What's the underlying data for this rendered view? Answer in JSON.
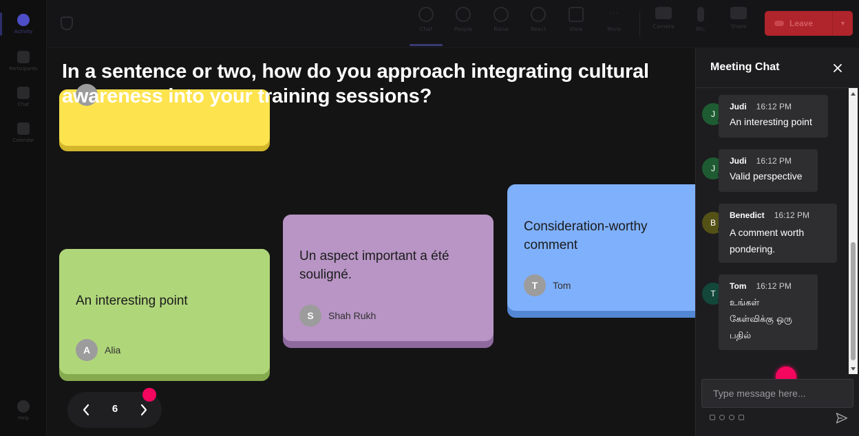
{
  "rail": {
    "items": [
      {
        "label": "Activity",
        "active": true
      },
      {
        "label": "Participants",
        "active": false
      },
      {
        "label": "Chat",
        "active": false
      },
      {
        "label": "Calendar",
        "active": false
      }
    ],
    "help_label": "Help"
  },
  "toolbar": {
    "items": [
      {
        "label": "Chat",
        "active": true
      },
      {
        "label": "People",
        "active": false
      },
      {
        "label": "Raise",
        "active": false
      },
      {
        "label": "React",
        "active": false
      },
      {
        "label": "View",
        "active": false
      },
      {
        "label": "More",
        "active": false
      },
      {
        "label": "Camera",
        "active": false
      },
      {
        "label": "Mic",
        "active": false
      },
      {
        "label": "Share",
        "active": false
      }
    ],
    "leave_label": "Leave"
  },
  "stage": {
    "question": "In a sentence or two, how do you approach integrating cultural awareness into your training sessions?",
    "cards": [
      {
        "text": "",
        "author": "",
        "initial": "",
        "color": "#fde34e",
        "shadow": "#d2b62b"
      },
      {
        "text": "An interesting point",
        "author": "Alia",
        "initial": "A",
        "color": "#b0d67a",
        "shadow": "#86ab4f"
      },
      {
        "text": "Un aspect important a été souligné.",
        "author": "Shah Rukh",
        "initial": "S",
        "color": "#b895c5",
        "shadow": "#8e6a9e"
      },
      {
        "text": "Consideration-worthy comment",
        "author": "Tom",
        "initial": "T",
        "color": "#7fb0fb",
        "shadow": "#5487d3"
      }
    ],
    "page_number": "6"
  },
  "chat": {
    "title": "Meeting Chat",
    "messages": [
      {
        "initial": "J",
        "name": "Judi",
        "time": "16:12 PM",
        "text": "An interesting point",
        "avatar_color": "#1f5b32"
      },
      {
        "initial": "J",
        "name": "Judi",
        "time": "16:12 PM",
        "text": "Valid perspective",
        "avatar_color": "#1f5b32"
      },
      {
        "initial": "B",
        "name": "Benedict",
        "time": "16:12 PM",
        "text": "A comment worth pondering.",
        "avatar_color": "#545117"
      },
      {
        "initial": "T",
        "name": "Tom",
        "time": "16:12 PM",
        "text": "உங்கள் கேள்விக்கு ஒரு பதில்",
        "avatar_color": "#124739"
      }
    ],
    "input_placeholder": "Type message here..."
  },
  "colors": {
    "accent_pink": "#f5065f",
    "leave_red": "#b0242b",
    "card_yellow": "#fde34e",
    "card_green": "#b0d67a",
    "card_purple": "#b895c5",
    "card_blue": "#7fb0fb"
  }
}
